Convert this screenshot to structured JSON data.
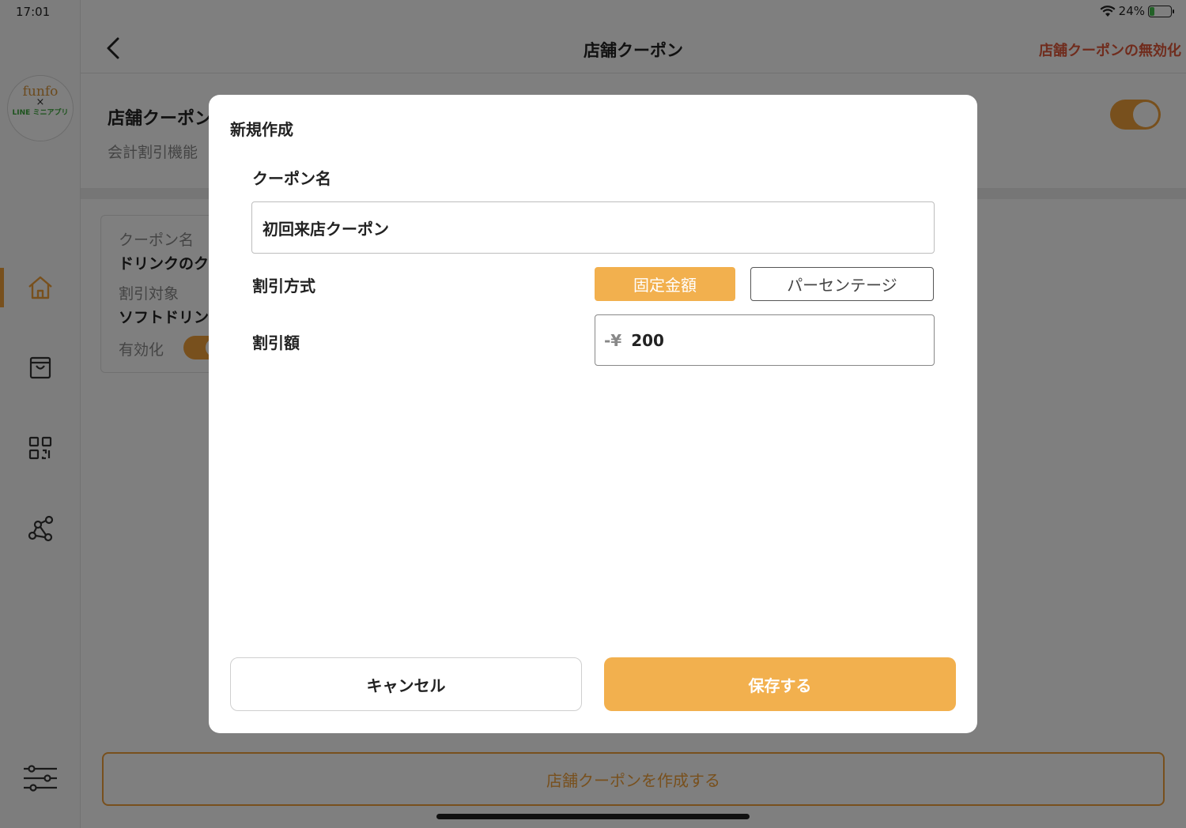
{
  "status_bar": {
    "time": "17:01",
    "battery": "24%",
    "battery_level": 0.24
  },
  "sidebar": {
    "logo": {
      "line1": "funfo",
      "line2": "×",
      "line3": "LINE ミニアプリ"
    },
    "items": [
      {
        "icon": "home-icon",
        "active": true
      },
      {
        "icon": "shopping-bag-icon",
        "active": false
      },
      {
        "icon": "qr-code-icon",
        "active": false
      },
      {
        "icon": "network-icon",
        "active": false
      },
      {
        "icon": "settings-sliders-icon",
        "active": false
      }
    ]
  },
  "header": {
    "title": "店舗クーポン",
    "action": "店舗クーポンの無効化"
  },
  "background": {
    "section_title": "店舗クーポン",
    "section_desc": "会計割引機能",
    "coupon_card": {
      "name_label": "クーポン名",
      "name_value": "ドリンクのク",
      "target_label": "割引対象",
      "target_value": "ソフトドリン",
      "enabled_label": "有効化"
    },
    "create_button": "店舗クーポンを作成する"
  },
  "modal": {
    "title": "新規作成",
    "coupon_name_label": "クーポン名",
    "coupon_name_value": "初回来店クーポン",
    "discount_method_label": "割引方式",
    "method_options": [
      "固定金額",
      "パーセンテージ"
    ],
    "selected_method": "固定金額",
    "discount_amount_label": "割引額",
    "amount_prefix": "-¥",
    "amount_value": "200",
    "cancel_label": "キャンセル",
    "save_label": "保存する"
  },
  "colors": {
    "accent": "#f2b04e",
    "danger": "#e0583a"
  }
}
